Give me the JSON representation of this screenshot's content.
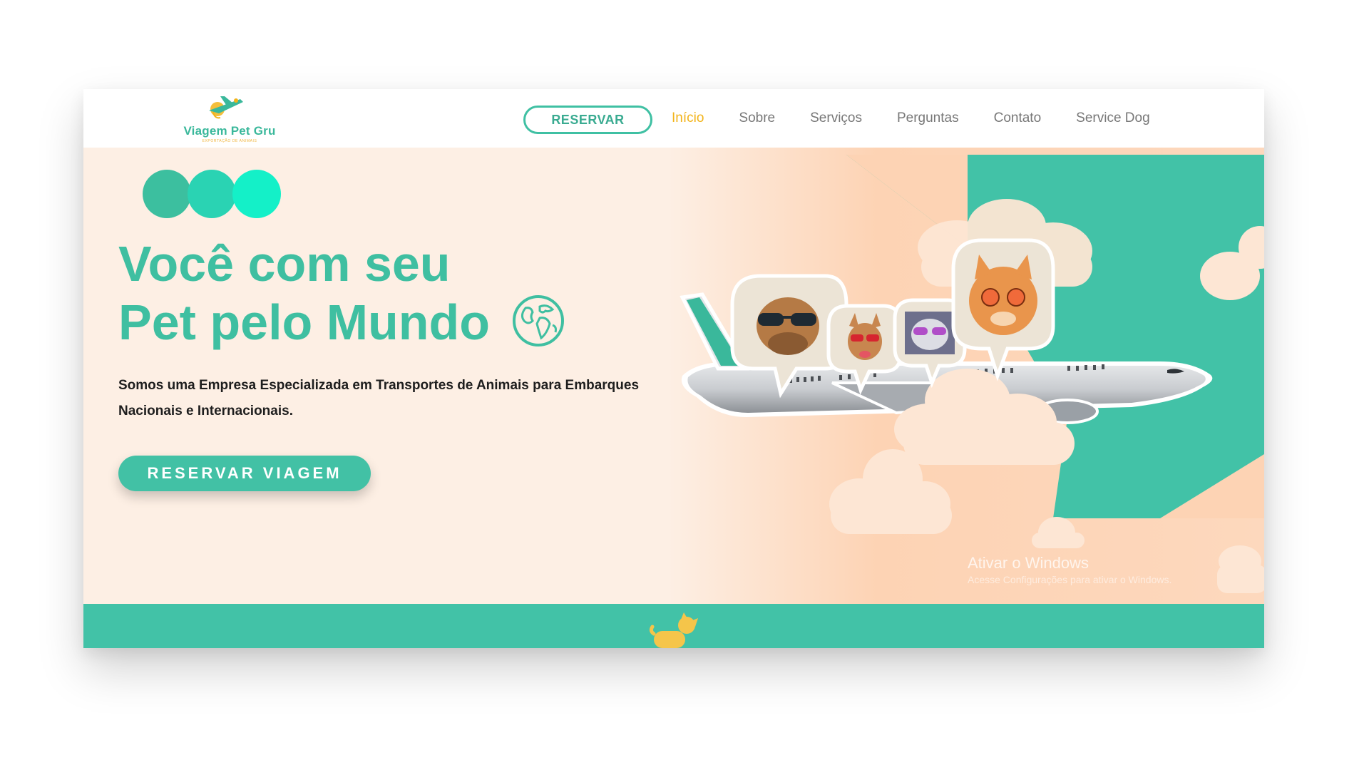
{
  "brand": {
    "name": "Viagem Pet Gru",
    "tagline": "EXPORTAÇÃO DE ANIMAIS",
    "primary_color": "#42c1a5",
    "accent_color": "#f2b319"
  },
  "nav": {
    "reserve_label": "RESERVAR",
    "links": [
      {
        "label": "Início",
        "active": true
      },
      {
        "label": "Sobre",
        "active": false
      },
      {
        "label": "Serviços",
        "active": false
      },
      {
        "label": "Perguntas",
        "active": false
      },
      {
        "label": "Contato",
        "active": false
      },
      {
        "label": "Service Dog",
        "active": false
      }
    ]
  },
  "hero": {
    "decor_dot_colors": [
      "#3cbf9f",
      "#2ad3b3",
      "#14f0c8"
    ],
    "headline_line1": "Você com seu",
    "headline_line2": "Pet pelo Mundo",
    "headline_icon": "globe-icon",
    "description": "Somos uma Empresa Especializada em Transportes de Animais para Embarques Nacionais e Internacionais.",
    "cta_label": "RESERVAR VIAGEM",
    "illustration": "airplane-with-pets-illustration",
    "pet_bubbles": [
      "dog-with-sunglasses",
      "small-dog-with-sunglasses",
      "cat-with-sunglasses",
      "orange-cat-with-sunglasses"
    ]
  },
  "footer": {
    "icon": "dog-icon",
    "color": "#42c2a7"
  },
  "watermark": {
    "title": "Ativar o Windows",
    "subtitle": "Acesse Configurações para ativar o Windows."
  }
}
